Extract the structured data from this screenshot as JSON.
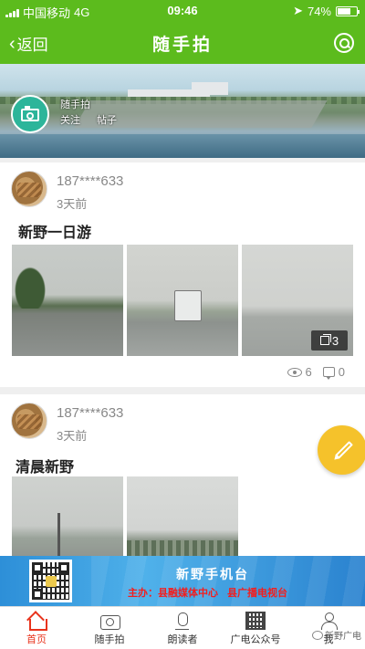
{
  "status_bar": {
    "carrier": "中国移动",
    "network": "4G",
    "time": "09:46",
    "battery": "74%",
    "battery_level": 0.74
  },
  "nav": {
    "back_label": "返回",
    "title": "随手拍"
  },
  "banner": {
    "name": "随手拍",
    "follow_label": "关注",
    "posts_label": "帖子"
  },
  "posts": [
    {
      "user": "187****633",
      "time": "3天前",
      "title": "新野一日游",
      "more_count": "3",
      "views": "6",
      "comments": "0"
    },
    {
      "user": "187****633",
      "time": "3天前",
      "title": "清晨新野"
    }
  ],
  "ad": {
    "title": "新野手机台",
    "host_prefix": "主办：",
    "host_1": "县融媒体中心",
    "host_2": "县广播电视台"
  },
  "tabs": [
    {
      "label": "首页",
      "icon": "home-icon"
    },
    {
      "label": "随手拍",
      "icon": "camera-icon"
    },
    {
      "label": "朗读者",
      "icon": "microphone-icon"
    },
    {
      "label": "广电公众号",
      "icon": "qr-code-icon"
    },
    {
      "label": "我",
      "icon": "user-icon"
    }
  ],
  "watermark": "新野广电",
  "colors": {
    "brand_green": "#5cbb1d",
    "fab_yellow": "#f5c22b",
    "active_red": "#e8331c",
    "camera_teal": "#2db59a"
  }
}
